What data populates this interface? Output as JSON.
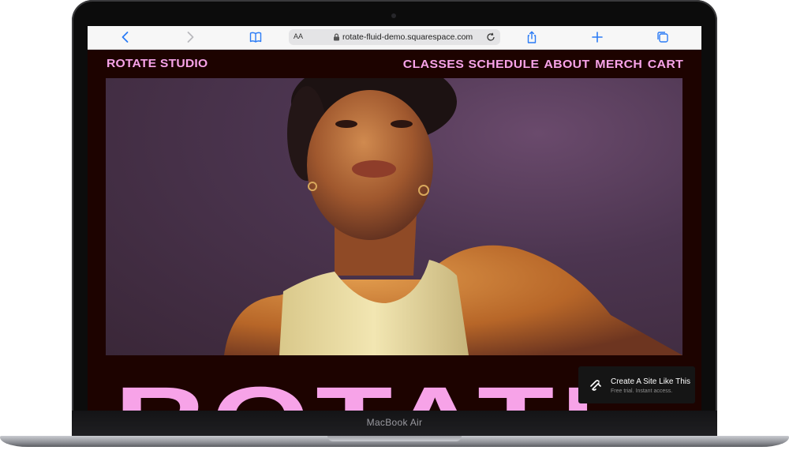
{
  "browser": {
    "url": "rotate-fluid-demo.squarespace.com",
    "text_size_label": "AA",
    "icons": [
      "back-arrow-icon",
      "forward-arrow-icon",
      "bookmarks-icon",
      "lock-icon",
      "reload-icon",
      "share-icon",
      "new-tab-icon",
      "tabs-icon"
    ]
  },
  "site": {
    "logo": "ROTATE STUDIO",
    "nav": [
      "CLASSES",
      "SCHEDULE",
      "ABOUT",
      "MERCH",
      "CART"
    ],
    "hero_word": "ROTATE",
    "accent_color": "#f7a3e8",
    "background_color": "#1d0300"
  },
  "cta": {
    "title": "Create A Site Like This",
    "subtitle": "Free trial. Instant access."
  },
  "device": {
    "label": "MacBook Air"
  }
}
